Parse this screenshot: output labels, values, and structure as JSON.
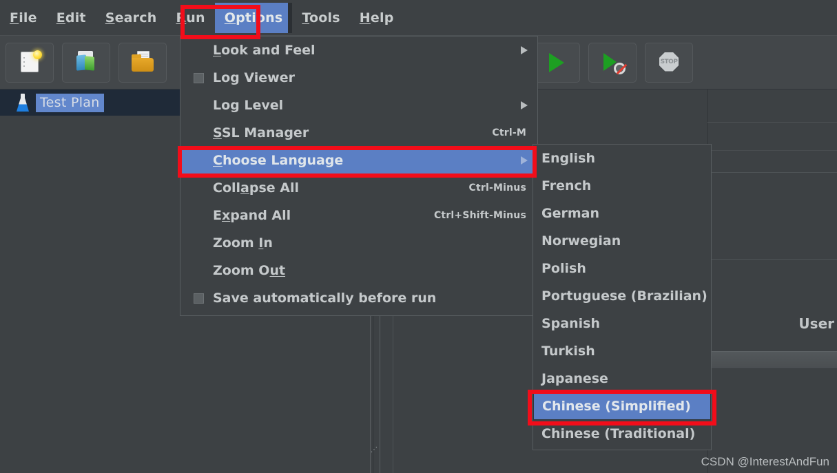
{
  "app": {
    "background": "#3d4144",
    "accent": "#5b7fc4",
    "annotation_color": "#f20d1a"
  },
  "menubar": {
    "items": [
      {
        "label": "File",
        "mnemonic": "F",
        "selected": false
      },
      {
        "label": "Edit",
        "mnemonic": "E",
        "selected": false
      },
      {
        "label": "Search",
        "mnemonic": "S",
        "selected": false
      },
      {
        "label": "Run",
        "mnemonic": "R",
        "selected": false
      },
      {
        "label": "Options",
        "mnemonic": "O",
        "selected": true
      },
      {
        "label": "Tools",
        "mnemonic": "T",
        "selected": false
      },
      {
        "label": "Help",
        "mnemonic": "H",
        "selected": false
      }
    ]
  },
  "toolbar": {
    "buttons": [
      {
        "icon": "new-file-icon"
      },
      {
        "icon": "templates-icon"
      },
      {
        "icon": "open-folder-icon"
      },
      {
        "icon": "remove-icon"
      },
      {
        "icon": "toggle-icon"
      },
      {
        "icon": "start-icon"
      },
      {
        "icon": "start-no-timers-icon"
      },
      {
        "icon": "stop-icon"
      }
    ]
  },
  "tree": {
    "root_label": "Test Plan",
    "root_icon": "flask-icon"
  },
  "options_menu": {
    "items": [
      {
        "label": "Look and Feel",
        "mnemonic": "L",
        "accel": "",
        "submenu": true,
        "checkbox": false,
        "highlight": false
      },
      {
        "label": "Log Viewer",
        "mnemonic": "",
        "accel": "",
        "submenu": false,
        "checkbox": true,
        "highlight": false
      },
      {
        "label": "Log Level",
        "mnemonic": "",
        "accel": "",
        "submenu": true,
        "checkbox": false,
        "highlight": false
      },
      {
        "label": "SSL Manager",
        "mnemonic": "S",
        "accel": "Ctrl-M",
        "submenu": false,
        "checkbox": false,
        "highlight": false
      },
      {
        "label": "Choose Language",
        "mnemonic": "C",
        "accel": "",
        "submenu": true,
        "checkbox": false,
        "highlight": true
      },
      {
        "label": "Collapse All",
        "mnemonic": "a",
        "accel": "Ctrl-Minus",
        "submenu": false,
        "checkbox": false,
        "highlight": false
      },
      {
        "label": "Expand All",
        "mnemonic": "x",
        "accel": "Ctrl+Shift-Minus",
        "submenu": false,
        "checkbox": false,
        "highlight": false
      },
      {
        "label": "Zoom In",
        "mnemonic": "I",
        "accel": "",
        "submenu": false,
        "checkbox": false,
        "highlight": false
      },
      {
        "label": "Zoom Out",
        "mnemonic": "ut",
        "accel": "",
        "submenu": false,
        "checkbox": false,
        "highlight": false
      },
      {
        "label": "Save automatically before run",
        "mnemonic": "",
        "accel": "",
        "submenu": false,
        "checkbox": true,
        "highlight": false
      }
    ]
  },
  "language_submenu": {
    "items": [
      {
        "label": "English",
        "highlight": false
      },
      {
        "label": "French",
        "highlight": false
      },
      {
        "label": "German",
        "highlight": false
      },
      {
        "label": "Norwegian",
        "highlight": false
      },
      {
        "label": "Polish",
        "highlight": false
      },
      {
        "label": "Portuguese (Brazilian)",
        "highlight": false
      },
      {
        "label": "Spanish",
        "highlight": false
      },
      {
        "label": "Turkish",
        "highlight": false
      },
      {
        "label": "Japanese",
        "highlight": false
      },
      {
        "label": "Chinese (Simplified)",
        "highlight": true
      },
      {
        "label": "Chinese (Traditional)",
        "highlight": false
      }
    ]
  },
  "right_panel": {
    "user_label": "User"
  },
  "watermark": {
    "text": "CSDN @InterestAndFun"
  }
}
